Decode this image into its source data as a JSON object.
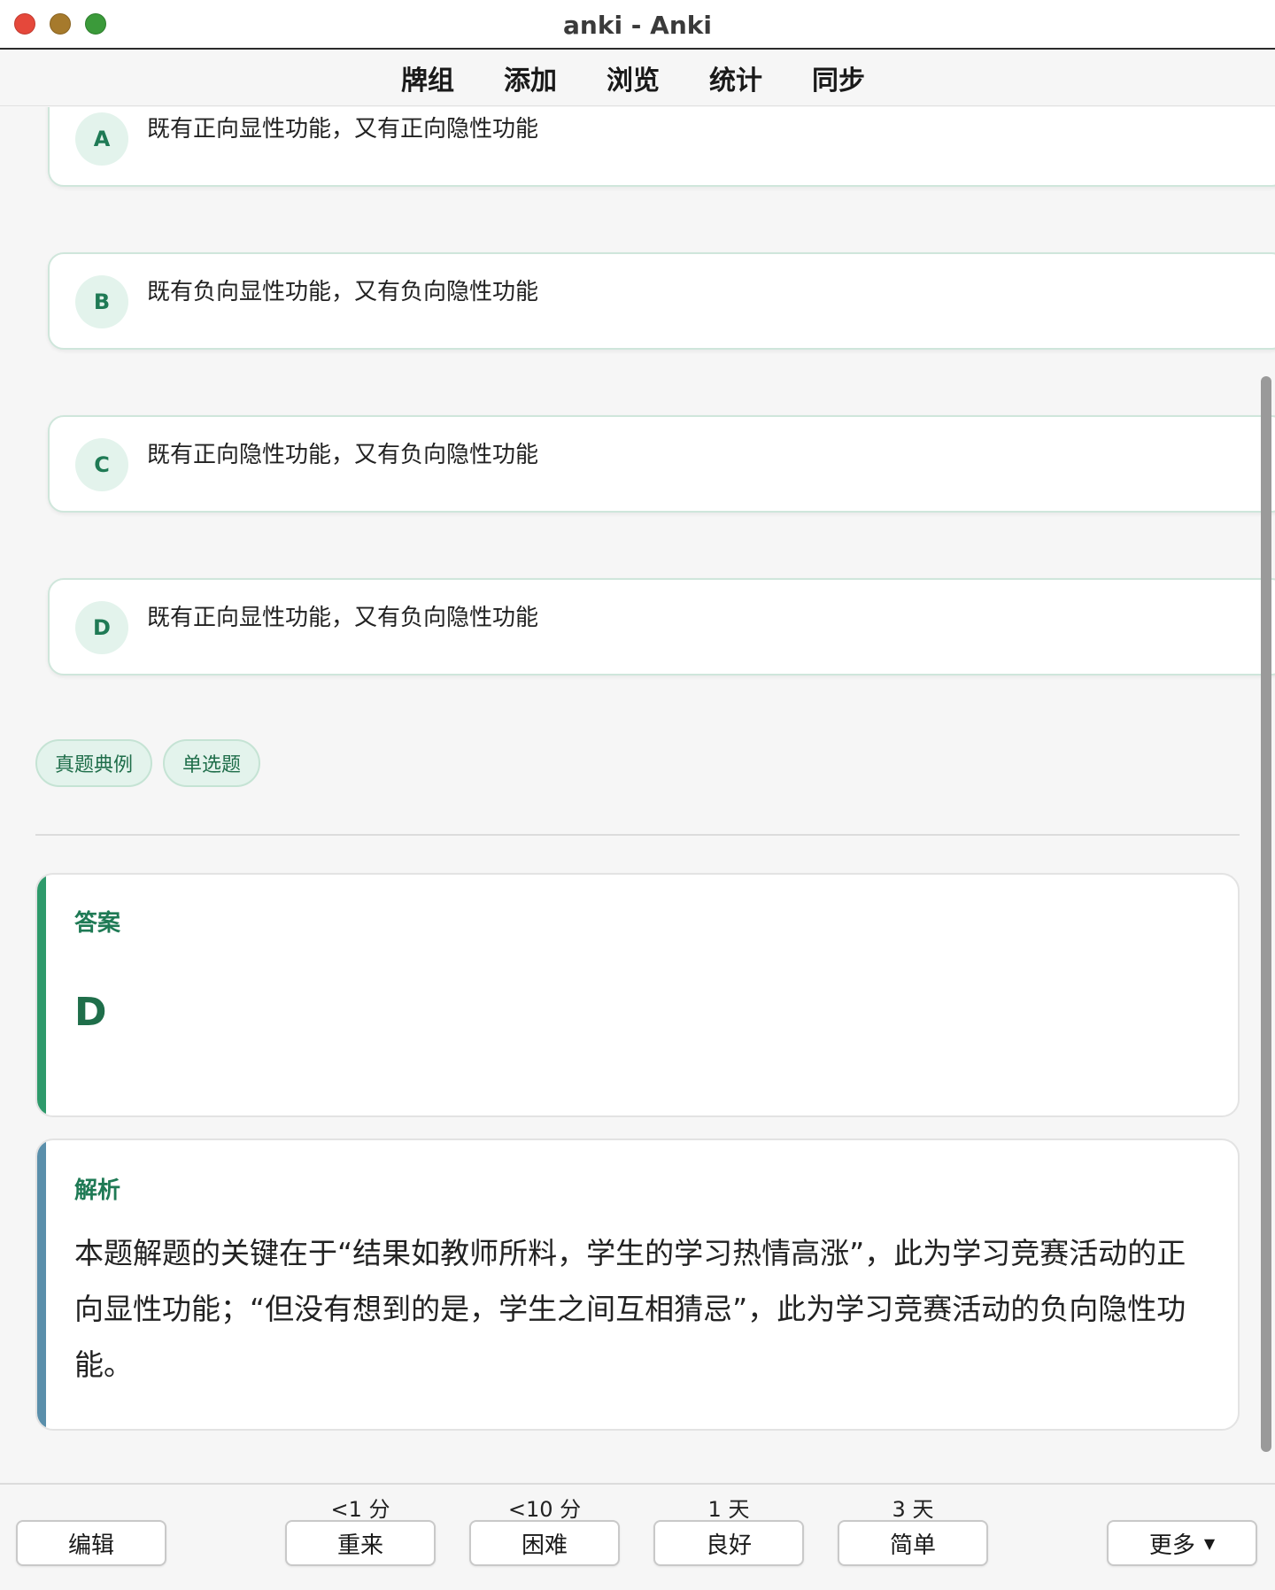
{
  "window": {
    "title": "anki - Anki"
  },
  "toolbar": {
    "items": [
      "牌组",
      "添加",
      "浏览",
      "统计",
      "同步"
    ]
  },
  "options": [
    {
      "letter": "A",
      "text": "既有正向显性功能，又有正向隐性功能"
    },
    {
      "letter": "B",
      "text": "既有负向显性功能，又有负向隐性功能"
    },
    {
      "letter": "C",
      "text": "既有正向隐性功能，又有负向隐性功能"
    },
    {
      "letter": "D",
      "text": "既有正向显性功能，又有负向隐性功能"
    }
  ],
  "tags": [
    "真题典例",
    "单选题"
  ],
  "answer": {
    "heading": "答案",
    "value": "D"
  },
  "analysis": {
    "heading": "解析",
    "body": "本题解题的关键在于“结果如教师所料，学生的学习热情高涨”，此为学习竞赛活动的正向显性功能；“但没有想到的是，学生之间互相猜忌”，此为学习竞赛活动的负向隐性功能。"
  },
  "review_bar": {
    "edit_label": "编辑",
    "more_label": "更多",
    "buttons": [
      {
        "label": "重来",
        "interval": "<1 分"
      },
      {
        "label": "困难",
        "interval": "<10 分"
      },
      {
        "label": "良好",
        "interval": "1 天"
      },
      {
        "label": "简单",
        "interval": "3 天"
      }
    ]
  }
}
